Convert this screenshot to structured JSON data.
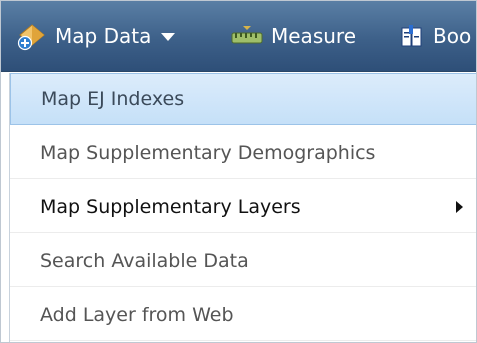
{
  "toolbar": {
    "map_data": {
      "label": "Map Data",
      "icon": "map-data-icon"
    },
    "measure": {
      "label": "Measure",
      "icon": "ruler-icon"
    },
    "book": {
      "label": "Boo",
      "icon": "bookmark-icon"
    }
  },
  "menu": {
    "items": [
      {
        "label": "Map EJ Indexes",
        "state": "highlighted"
      },
      {
        "label": "Map Supplementary Demographics"
      },
      {
        "label": "Map Supplementary Layers",
        "has_submenu": true
      },
      {
        "label": "Search Available Data"
      },
      {
        "label": "Add Layer from Web"
      }
    ]
  },
  "colors": {
    "toolbar_bg": "#3d6089",
    "highlight_bg": "#c5e0f8",
    "text": "#555555"
  }
}
